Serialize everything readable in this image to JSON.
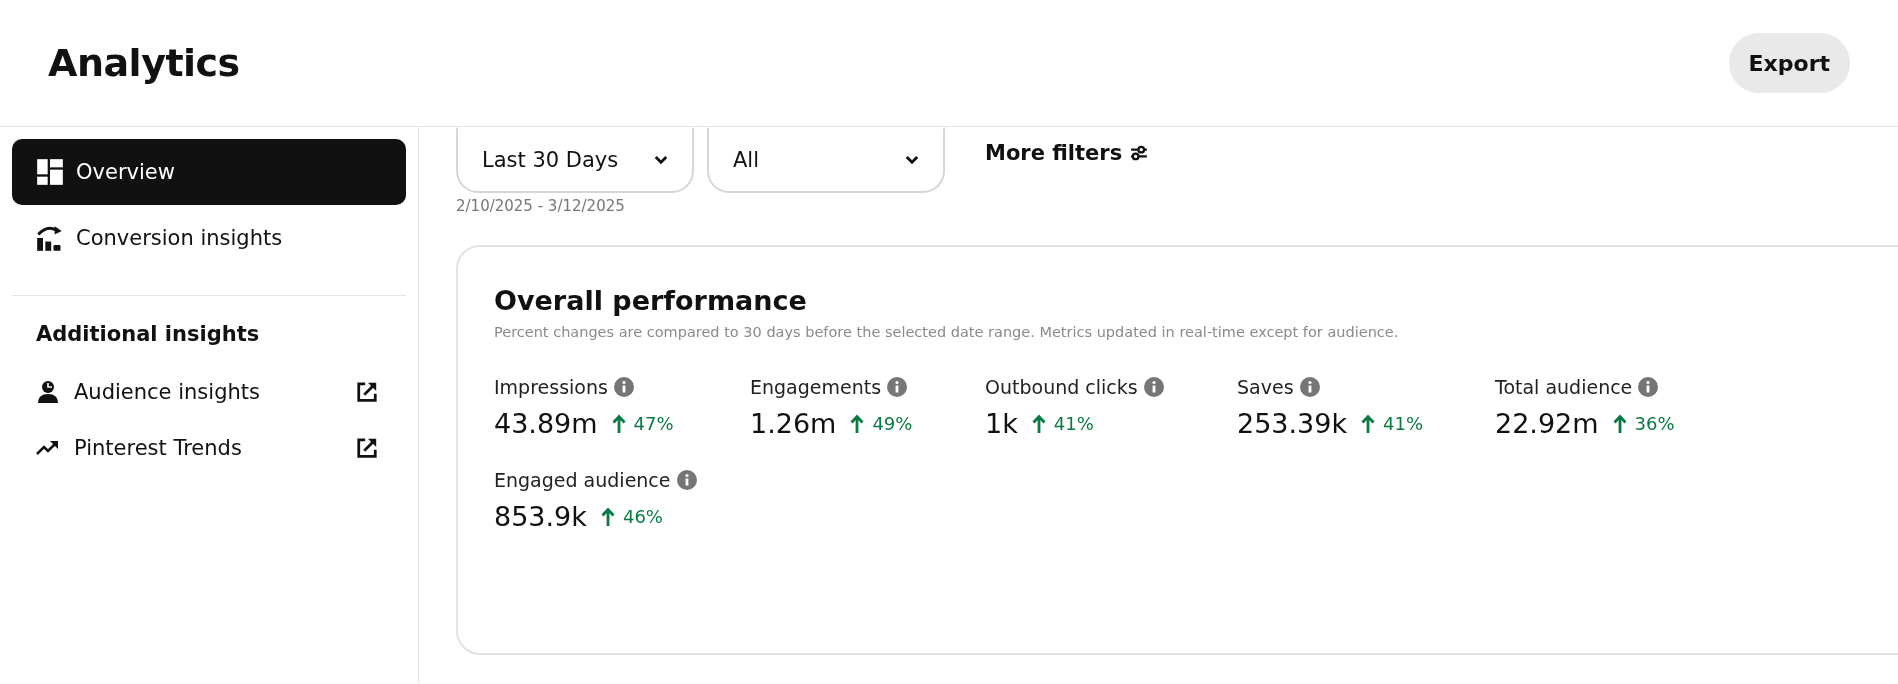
{
  "header": {
    "title": "Analytics",
    "export_button": "Export"
  },
  "sidebar": {
    "items": [
      {
        "label": "Overview",
        "kind": "grid",
        "selected": true
      },
      {
        "label": "Conversion insights",
        "kind": "conversion",
        "selected": false
      }
    ],
    "section_title": "Additional insights",
    "links": [
      {
        "label": "Audience insights",
        "kind": "audience"
      },
      {
        "label": "Pinterest Trends",
        "kind": "trend"
      }
    ]
  },
  "filters": {
    "dropdowns": [
      {
        "value": "Last 30 Days"
      },
      {
        "value": "All"
      }
    ],
    "more_filters": "More filters",
    "date_range": "2/10/2025 - 3/12/2025"
  },
  "card": {
    "title": "Overall performance",
    "subtitle": "Percent changes are compared to 30 days before the selected date range. Metrics updated in real-time except for audience.",
    "metrics": [
      {
        "label": "Impressions",
        "value": "43.89m",
        "change": "47%",
        "kind": "increase"
      },
      {
        "label": "Engagements",
        "value": "1.26m",
        "change": "49%",
        "kind": "increase"
      },
      {
        "label": "Outbound clicks",
        "value": "1k",
        "change": "41%",
        "kind": "increase"
      },
      {
        "label": "Saves",
        "value": "253.39k",
        "change": "41%",
        "kind": "increase"
      },
      {
        "label": "Total audience",
        "value": "22.92m",
        "change": "36%",
        "kind": "increase"
      },
      {
        "label": "Engaged audience",
        "value": "853.9k",
        "change": "46%",
        "kind": "increase"
      }
    ]
  }
}
